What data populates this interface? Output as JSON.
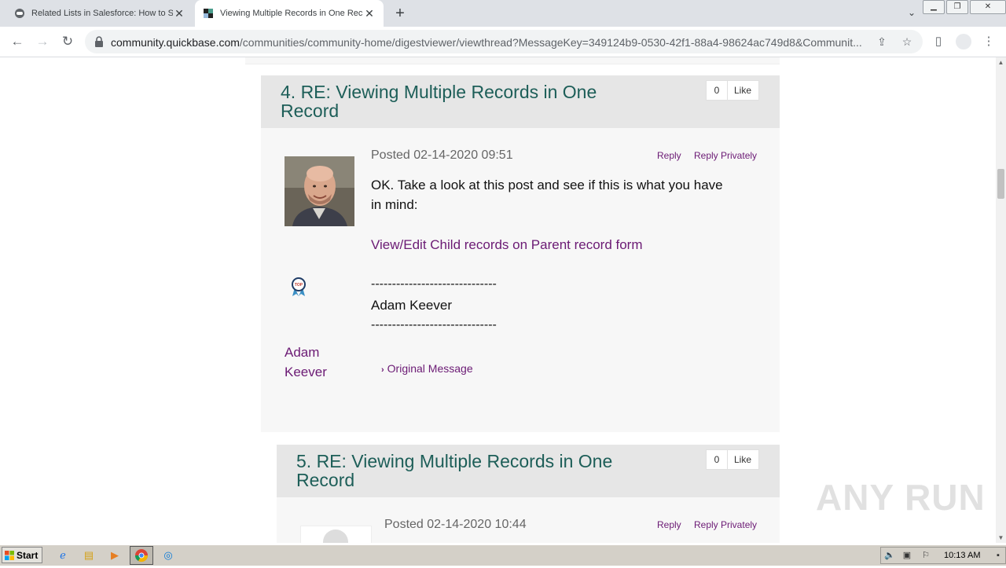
{
  "browser": {
    "tabs": [
      {
        "title": "Related Lists in Salesforce: How to S",
        "active": false
      },
      {
        "title": "Viewing Multiple Records in One Rec",
        "active": true
      }
    ],
    "url_domain": "community.quickbase.com",
    "url_path": "/communities/community-home/digestviewer/viewthread?MessageKey=349124b9-0530-42f1-88a4-98624ac749d8&Communit..."
  },
  "posts": [
    {
      "number": "4.",
      "title": "RE: Viewing Multiple Records in One Record",
      "title_line1": "4.  RE: Viewing Multiple Records in One",
      "title_line2": "Record",
      "like_count": "0",
      "like_label": "Like",
      "posted": "Posted 02-14-2020 09:51",
      "reply_label": "Reply",
      "reply_privately_label": "Reply Privately",
      "body_line1": "OK. Take a look at this post and see if this is what you have",
      "body_line2": "in mind:",
      "link_text": "View/Edit Child records on Parent record form",
      "dashes": "------------------------------",
      "signature": "Adam Keever",
      "author_first": "Adam",
      "author_last": "Keever",
      "original_message_label": "Original Message"
    },
    {
      "number": "5.",
      "title_line1": "5.  RE: Viewing Multiple Records in One",
      "title_line2": "Record",
      "like_count": "0",
      "like_label": "Like",
      "posted": "Posted 02-14-2020 10:44",
      "reply_label": "Reply",
      "reply_privately_label": "Reply Privately"
    }
  ],
  "watermark": "ANY RUN",
  "taskbar": {
    "start_label": "Start",
    "clock": "10:13 AM"
  },
  "colors": {
    "title_green": "#1d5e58",
    "link_purple": "#6b1a74",
    "post_bg": "#f7f7f7",
    "header_bg": "#e6e6e6"
  }
}
